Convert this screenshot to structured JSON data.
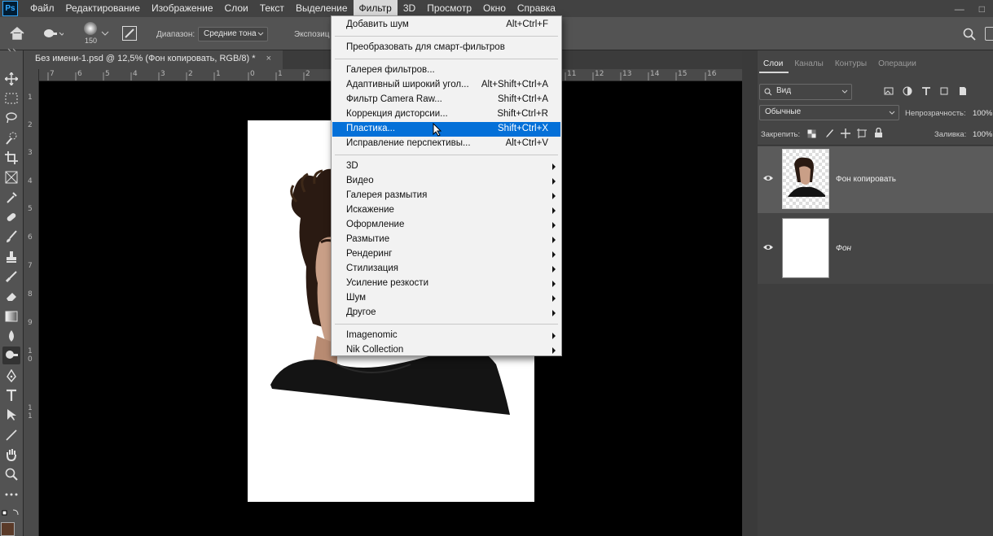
{
  "app": {
    "logo_text": "Ps",
    "menu": [
      "Файл",
      "Редактирование",
      "Изображение",
      "Слои",
      "Текст",
      "Выделение",
      "Фильтр",
      "3D",
      "Просмотр",
      "Окно",
      "Справка"
    ],
    "active_menu": "Фильтр"
  },
  "options": {
    "brush_size": "150",
    "range_label": "Диапазон:",
    "range_value": "Средние тона",
    "exposure_label": "Экспозиц"
  },
  "document": {
    "tab_title": "Без имени-1.psd @ 12,5% (Фон копировать, RGB/8) *",
    "close_glyph": "×",
    "ruler_top_labels": [
      "7",
      "6",
      "5",
      "4",
      "3",
      "2",
      "1",
      "0",
      "1",
      "2",
      "11",
      "12",
      "13",
      "14",
      "15",
      "16"
    ],
    "ruler_left_labels": [
      "1",
      "2",
      "3",
      "4",
      "5",
      "6",
      "7",
      "8",
      "9",
      "1\n0",
      "1\n1"
    ]
  },
  "filter_menu": {
    "items": [
      {
        "label": "Добавить шум",
        "shortcut": "Alt+Ctrl+F"
      },
      {
        "label": "Преобразовать для смарт-фильтров",
        "shortcut": ""
      },
      {
        "label": "Галерея фильтров...",
        "shortcut": ""
      },
      {
        "label": "Адаптивный широкий угол...",
        "shortcut": "Alt+Shift+Ctrl+A"
      },
      {
        "label": "Фильтр Camera Raw...",
        "shortcut": "Shift+Ctrl+A"
      },
      {
        "label": "Коррекция дисторсии...",
        "shortcut": "Shift+Ctrl+R"
      },
      {
        "label": "Пластика...",
        "shortcut": "Shift+Ctrl+X",
        "highlighted": true
      },
      {
        "label": "Исправление перспективы...",
        "shortcut": "Alt+Ctrl+V"
      },
      {
        "label": "3D",
        "submenu": true
      },
      {
        "label": "Видео",
        "submenu": true
      },
      {
        "label": "Галерея размытия",
        "submenu": true
      },
      {
        "label": "Искажение",
        "submenu": true
      },
      {
        "label": "Оформление",
        "submenu": true
      },
      {
        "label": "Размытие",
        "submenu": true
      },
      {
        "label": "Рендеринг",
        "submenu": true
      },
      {
        "label": "Стилизация",
        "submenu": true
      },
      {
        "label": "Усиление резкости",
        "submenu": true
      },
      {
        "label": "Шум",
        "submenu": true
      },
      {
        "label": "Другое",
        "submenu": true
      },
      {
        "label": "Imagenomic",
        "submenu": true
      },
      {
        "label": "Nik Collection",
        "submenu": true
      }
    ]
  },
  "layers_panel": {
    "tabs": [
      "Слои",
      "Каналы",
      "Контуры",
      "Операции"
    ],
    "active_tab": "Слои",
    "filter_kind": "Вид",
    "blend_mode": "Обычные",
    "opacity_label": "Непрозрачность:",
    "opacity_value": "100%",
    "lock_label": "Закрепить:",
    "fill_label": "Заливка:",
    "fill_value": "100%",
    "layers": [
      {
        "name": "Фон копировать",
        "selected": true
      },
      {
        "name": "Фон",
        "selected": false
      }
    ]
  },
  "colors": {
    "accent": "#0470d8",
    "foreground_swatch": "#5a3a28"
  }
}
